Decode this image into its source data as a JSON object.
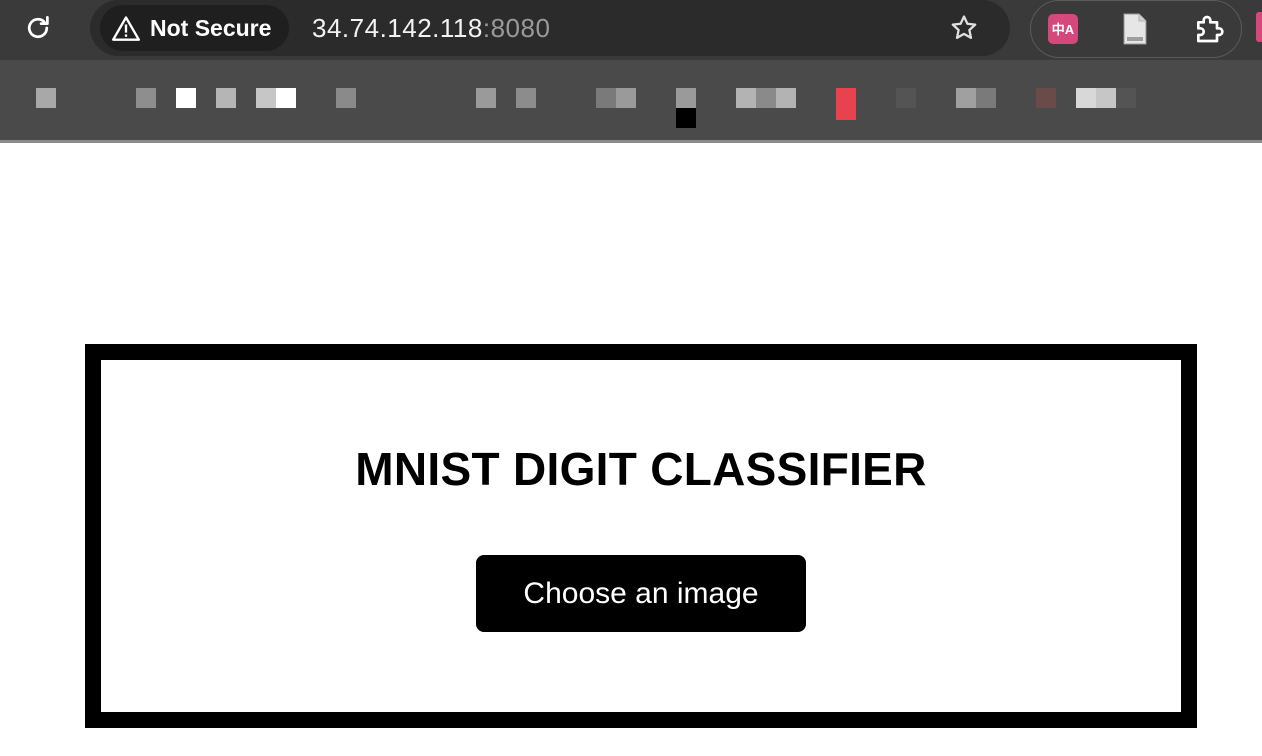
{
  "browser": {
    "security_label": "Not Secure",
    "url_host": "34.74.142.118",
    "url_port": ":8080",
    "translate_badge": "中A",
    "icons": {
      "reload": "reload-icon",
      "warning": "warning-icon",
      "bookmark": "star-icon",
      "translate": "translate-icon",
      "page": "document-icon",
      "extensions": "puzzle-icon"
    }
  },
  "bookmarks": {
    "colors": [
      "#a8a8a8",
      "#8e8e8e",
      "#ffffff",
      "#b5b5b5",
      "#c6c6c6",
      "#8a8a8a",
      "#9a9a9a",
      "#8c8c8c",
      "#7a7a7a",
      "#000000",
      "#b3b3b3",
      "#e8414f",
      "#545454",
      "#a0a0a0",
      "#6b4a4a",
      "#d8d8d8"
    ]
  },
  "page": {
    "title": "MNIST DIGIT CLASSIFIER",
    "choose_button_label": "Choose an image"
  },
  "colors": {
    "chrome_bg": "#3a3a3a",
    "omnibox_bg": "#2b2b2b",
    "bookmarks_bg": "#4a4a4a",
    "translate_accent": "#d6477b",
    "card_border": "#000000",
    "button_bg": "#000000",
    "button_text": "#ffffff"
  }
}
